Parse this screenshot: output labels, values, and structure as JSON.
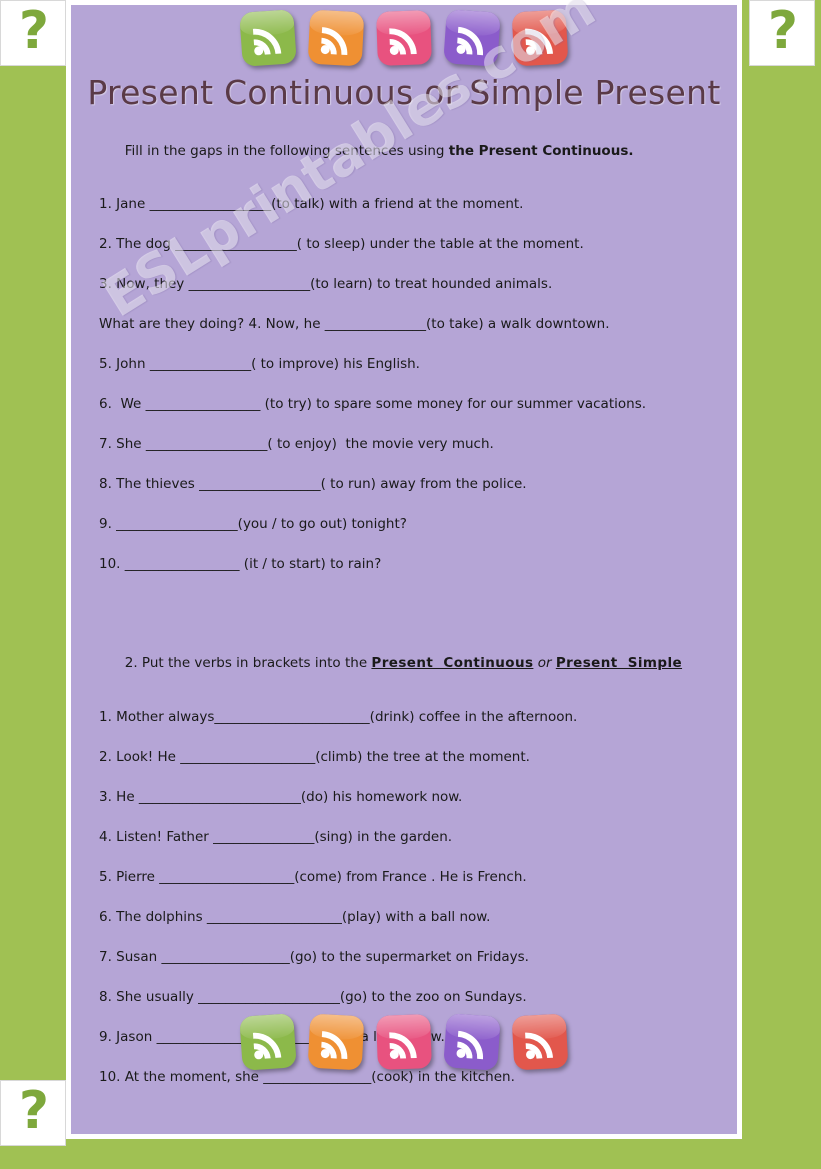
{
  "page": {
    "title": "Present Continuous or Simple Present",
    "watermark": "ESLprintables.com",
    "corner_badge": "?"
  },
  "colors": {
    "background": "#a0c153",
    "sheet": "#b5a5d6",
    "title": "#5a3a47",
    "badge_text": "#7ea83c"
  },
  "icons": {
    "top": [
      {
        "name": "rss-icon-green",
        "color": "#8cb94a"
      },
      {
        "name": "rss-icon-orange",
        "color": "#ef9033"
      },
      {
        "name": "rss-icon-pink",
        "color": "#e8527f"
      },
      {
        "name": "rss-icon-purple",
        "color": "#8b5ccb"
      },
      {
        "name": "rss-icon-red",
        "color": "#e2574c"
      }
    ],
    "bottom": [
      {
        "name": "rss-icon-green",
        "color": "#8cb94a"
      },
      {
        "name": "rss-icon-orange",
        "color": "#ef9033"
      },
      {
        "name": "rss-icon-pink",
        "color": "#e8527f"
      },
      {
        "name": "rss-icon-purple",
        "color": "#8b5ccb"
      },
      {
        "name": "rss-icon-red",
        "color": "#e2574c"
      }
    ]
  },
  "section1": {
    "instruction_plain": "Fill in the gaps in the following sentences using ",
    "instruction_bold": "the Present Continuous.",
    "items": [
      "1. Jane __________________(to talk) with a friend at the moment.",
      "2. The dog __________________( to sleep) under the table at the moment.",
      "3. Now, they __________________(to learn) to treat hounded animals.",
      "What are they doing? 4. Now, he _______________(to take) a walk downtown.",
      "5. John _______________( to improve) his English.",
      "6.  We _________________ (to try) to spare some money for our summer vacations.",
      "7. She __________________( to enjoy)  the movie very much.",
      "8. The thieves __________________( to run) away from the police.",
      "9. __________________(you / to go out) tonight?",
      "10. _________________ (it / to start) to rain?"
    ]
  },
  "section2": {
    "instruction_plain_1": "2. Put the verbs in brackets into the ",
    "instruction_bold_1": "Present  Continuous",
    "instruction_italic": " or ",
    "instruction_bold_2": "Present  Simple",
    "items": [
      "1. Mother always_______________________(drink) coffee in the afternoon.",
      "2. Look! He ____________________(climb) the tree at the moment.",
      "3. He ________________________(do) his homework now.",
      "4. Listen! Father _______________(sing) in the garden.",
      "5. Pierre ____________________(come) from France . He is French.",
      "6. The dolphins ____________________(play) with a ball now.",
      "7. Susan ___________________(go) to the supermarket on Fridays.",
      "8. She usually _____________________(go) to the zoo on Sundays.",
      "9. Jason _______________________(write) a letter now.",
      "10. At the moment, she ________________(cook) in the kitchen."
    ]
  }
}
